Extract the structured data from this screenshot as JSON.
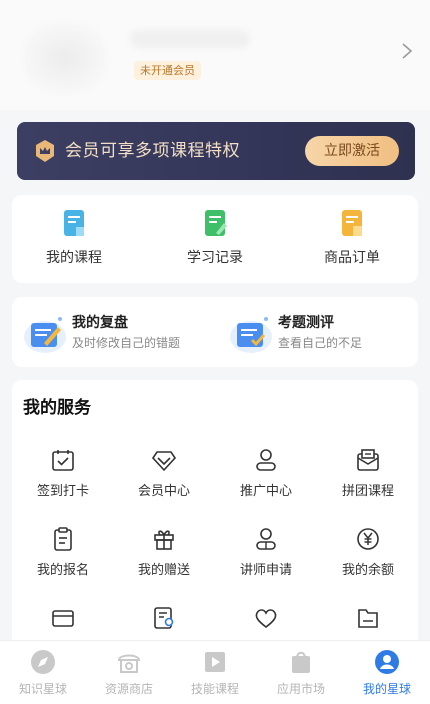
{
  "profile": {
    "member_status": "未开通会员"
  },
  "vip": {
    "text": "会员可享多项课程特权",
    "button": "立即激活"
  },
  "quick": [
    {
      "label": "我的课程",
      "icon": "course-book-icon",
      "color": "#4ab3e6"
    },
    {
      "label": "学习记录",
      "icon": "study-record-icon",
      "color": "#3fbf6a"
    },
    {
      "label": "商品订单",
      "icon": "order-icon",
      "color": "#f3b53b"
    }
  ],
  "reviews": [
    {
      "title": "我的复盘",
      "subtitle": "及时修改自己的错题",
      "icon": "review-notebook-icon"
    },
    {
      "title": "考题测评",
      "subtitle": "查看自己的不足",
      "icon": "exam-evaluation-icon"
    }
  ],
  "services": {
    "title": "我的服务",
    "items": [
      {
        "label": "签到打卡",
        "icon": "calendar-check-icon"
      },
      {
        "label": "会员中心",
        "icon": "diamond-icon"
      },
      {
        "label": "推广中心",
        "icon": "person-icon"
      },
      {
        "label": "拼团课程",
        "icon": "mail-icon"
      },
      {
        "label": "我的报名",
        "icon": "clipboard-icon"
      },
      {
        "label": "我的赠送",
        "icon": "gift-icon"
      },
      {
        "label": "讲师申请",
        "icon": "teacher-icon"
      },
      {
        "label": "我的余额",
        "icon": "yen-coin-icon"
      },
      {
        "label": "",
        "icon": "card-icon"
      },
      {
        "label": "",
        "icon": "certificate-icon"
      },
      {
        "label": "",
        "icon": "heart-icon"
      },
      {
        "label": "",
        "icon": "folder-icon"
      }
    ]
  },
  "tabs": [
    {
      "label": "知识星球",
      "icon": "compass-icon",
      "active": false
    },
    {
      "label": "资源商店",
      "icon": "store-icon",
      "active": false
    },
    {
      "label": "技能课程",
      "icon": "video-icon",
      "active": false
    },
    {
      "label": "应用市场",
      "icon": "bag-icon",
      "active": false
    },
    {
      "label": "我的星球",
      "icon": "user-circle-icon",
      "active": true
    }
  ],
  "colors": {
    "accent": "#2f7be6",
    "vip_bg": "#35375a",
    "vip_text": "#f3dfc4",
    "vip_button": "#f3c98f"
  }
}
